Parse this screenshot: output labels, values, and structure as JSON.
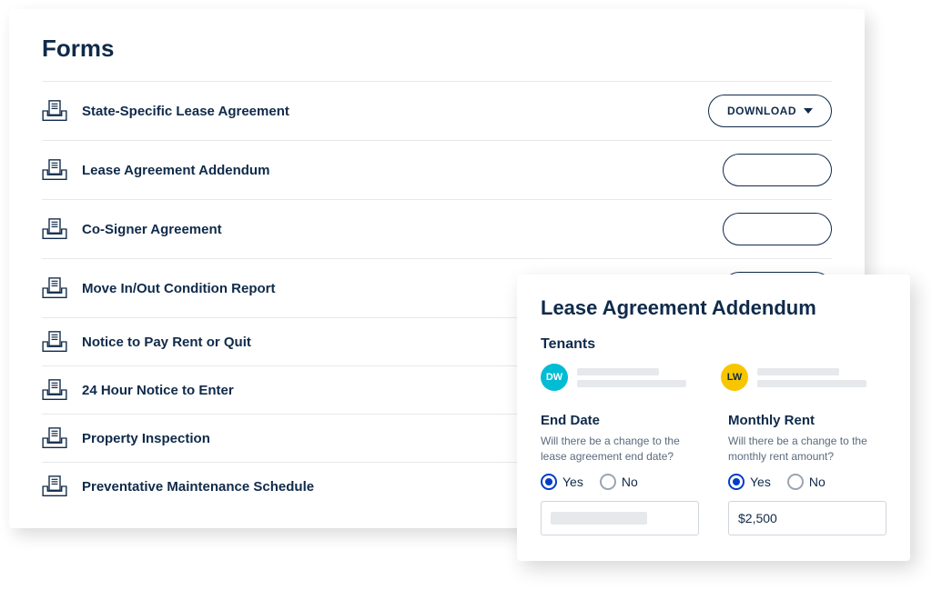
{
  "forms": {
    "title": "Forms",
    "download_label": "DOWNLOAD",
    "items": [
      {
        "label": "State-Specific Lease Agreement",
        "action": "download"
      },
      {
        "label": "Lease Agreement Addendum",
        "action": "empty"
      },
      {
        "label": "Co-Signer Agreement",
        "action": "empty"
      },
      {
        "label": "Move In/Out Condition Report",
        "action": "empty"
      },
      {
        "label": "Notice to Pay Rent or Quit",
        "action": "none"
      },
      {
        "label": "24 Hour Notice to Enter",
        "action": "none"
      },
      {
        "label": "Property Inspection",
        "action": "none"
      },
      {
        "label": "Preventative Maintenance Schedule",
        "action": "none"
      }
    ]
  },
  "modal": {
    "title": "Lease Agreement Addendum",
    "tenants_heading": "Tenants",
    "tenants": [
      {
        "initials": "DW",
        "color": "cyan"
      },
      {
        "initials": "LW",
        "color": "yellow"
      }
    ],
    "end_date": {
      "heading": "End Date",
      "sub": "Will there be a change to the lease agreement end date?",
      "yes": "Yes",
      "no": "No",
      "selected": "yes",
      "value": ""
    },
    "monthly_rent": {
      "heading": "Monthly Rent",
      "sub": "Will there be a change to the monthly rent amount?",
      "yes": "Yes",
      "no": "No",
      "selected": "yes",
      "value": "$2,500"
    }
  }
}
